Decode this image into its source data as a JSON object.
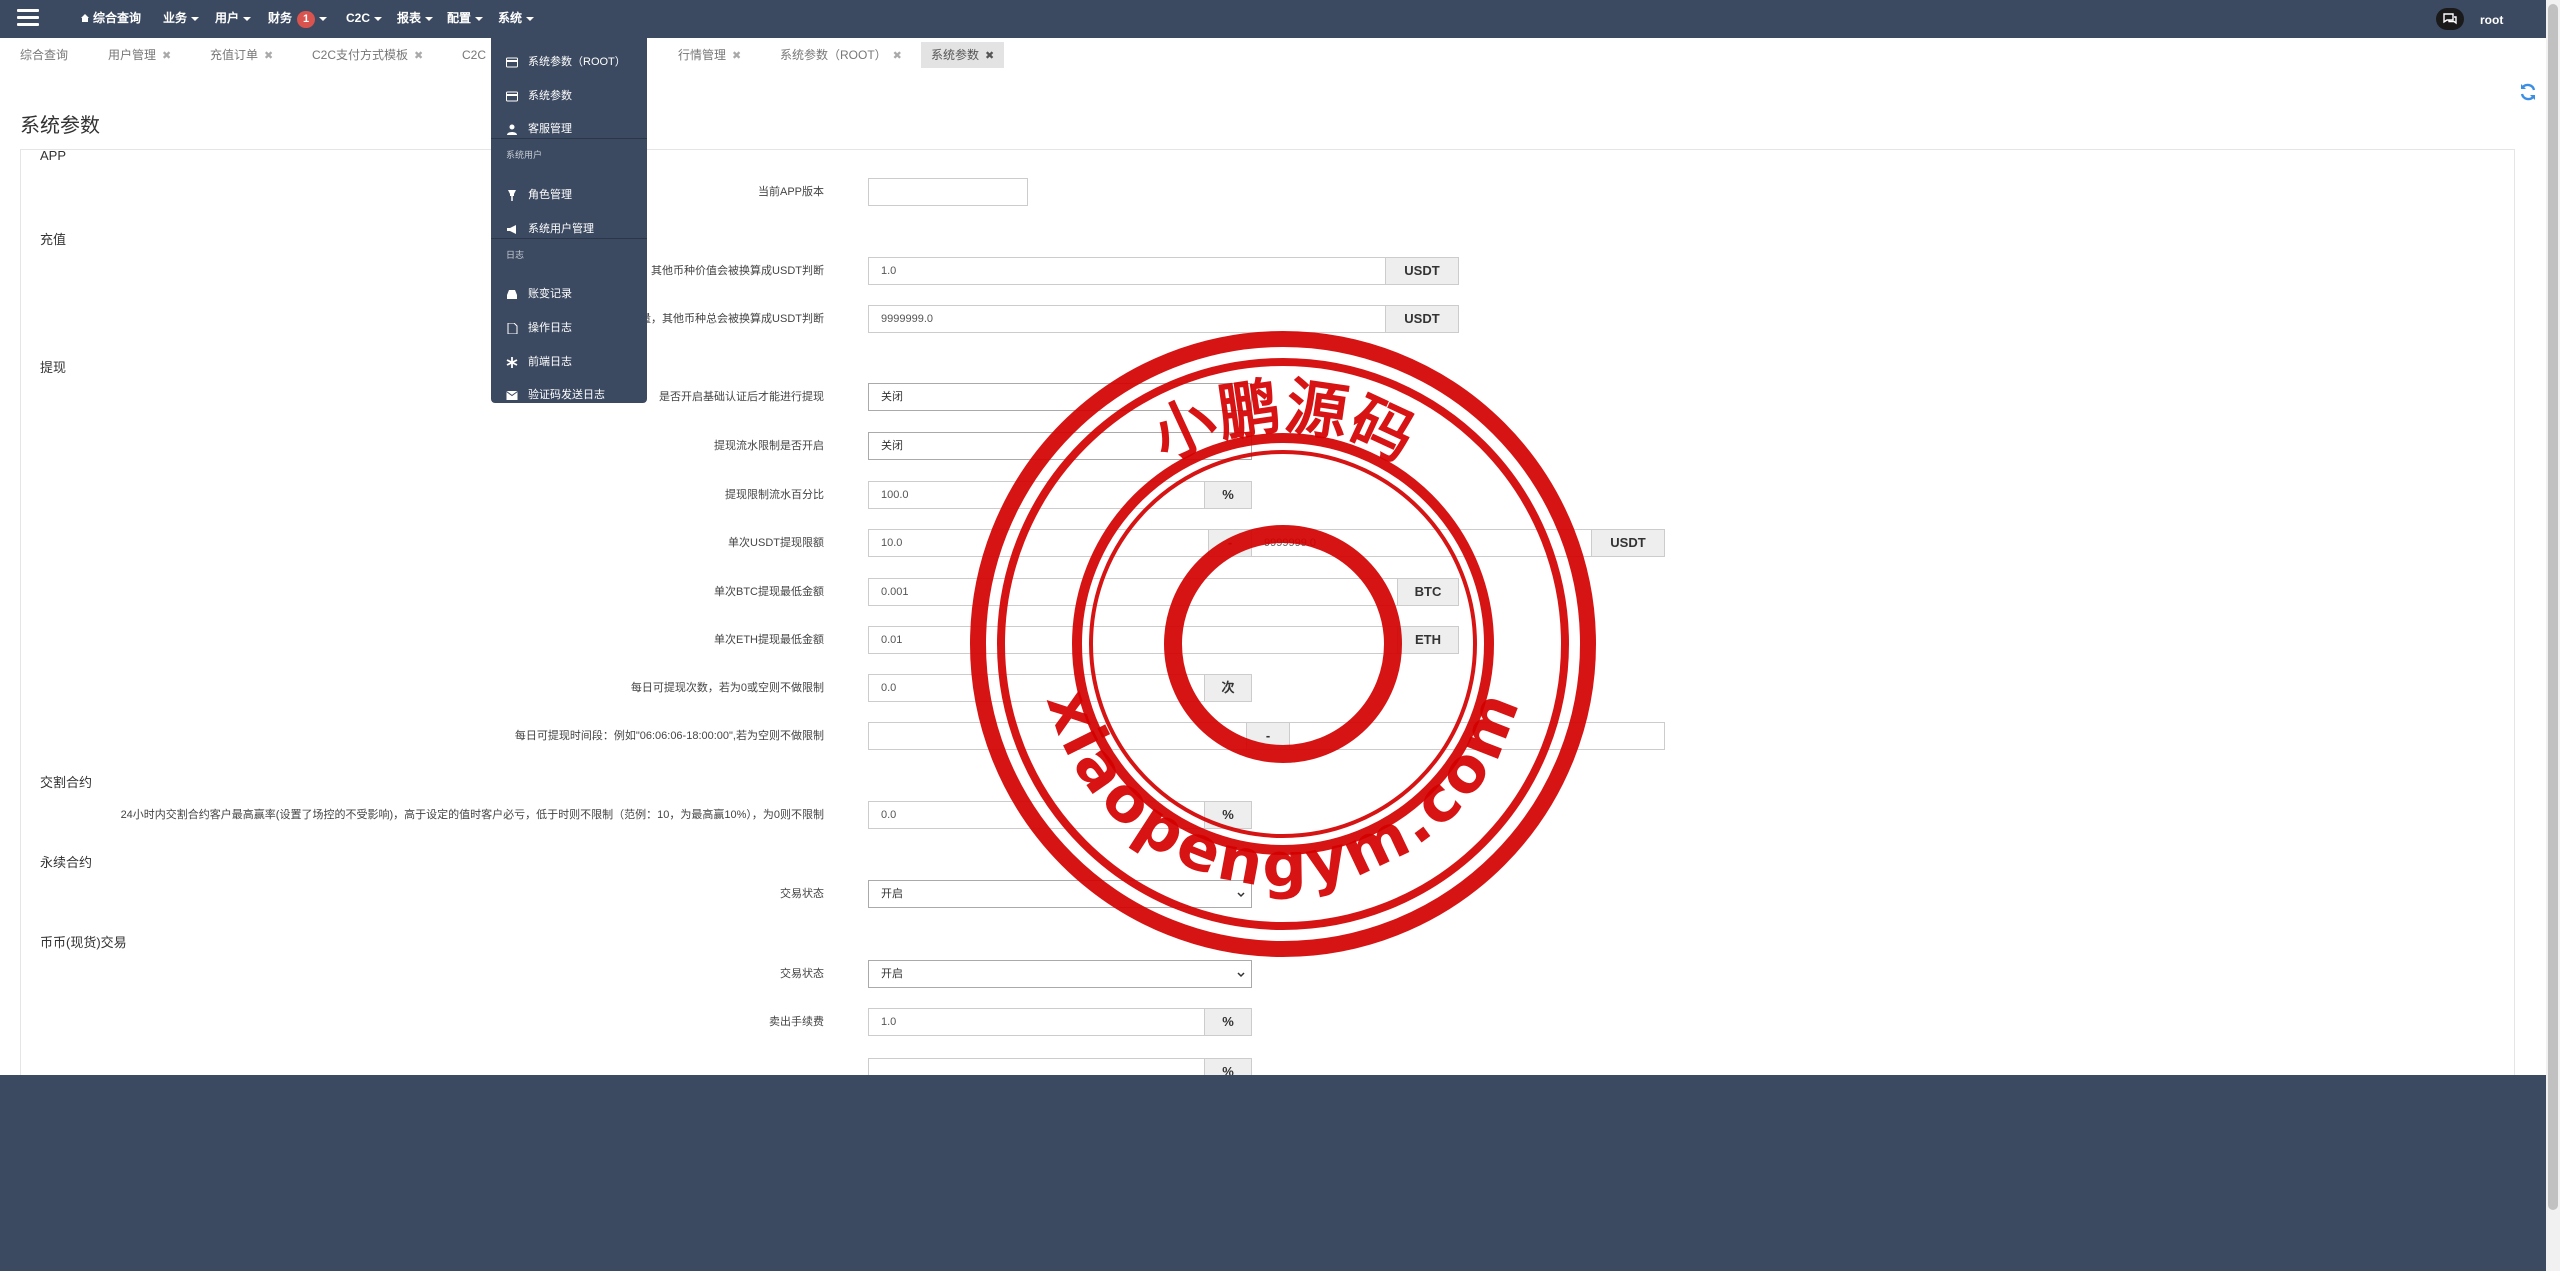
{
  "nav": {
    "home": "综合查询",
    "business": "业务",
    "users": "用户",
    "finance": "财务",
    "finance_badge": "1",
    "c2c": "C2C",
    "reports": "报表",
    "config": "配置",
    "system": "系统",
    "user_name": "root"
  },
  "tabs": [
    "综合查询",
    "用户管理",
    "充值订单",
    "C2C支付方式模板",
    "C2C",
    "行情管理",
    "系统参数（ROOT）",
    "系统参数"
  ],
  "page_title": "系统参数",
  "menu": {
    "items_top": [
      "系统参数（ROOT）",
      "系统参数",
      "客服管理"
    ],
    "header_users": "系统用户",
    "items_users": [
      "角色管理",
      "系统用户管理"
    ],
    "header_logs": "日志",
    "items_logs": [
      "账变记录",
      "操作日志",
      "前端日志",
      "验证码发送日志"
    ]
  },
  "sections": {
    "app": "APP",
    "recharge": "充值",
    "withdraw": "提现",
    "delivery": "交割合约",
    "perpetual": "永续合约",
    "spot": "币币(现货)交易"
  },
  "fields": {
    "app_version": {
      "label": "当前APP版本",
      "value": ""
    },
    "recharge_min": {
      "label": "量，其他币种价值会被换算成USDT判断",
      "value": "1.0",
      "unit": "USDT"
    },
    "recharge_max": {
      "label": "数量，其他币种总会被换算成USDT判断",
      "value": "9999999.0",
      "unit": "USDT"
    },
    "kyc_required": {
      "label": "是否开启基础认证后才能进行提现",
      "value": "关闭"
    },
    "flow_limit": {
      "label": "提现流水限制是否开启",
      "value": "关闭"
    },
    "flow_pct": {
      "label": "提现限制流水百分比",
      "value": "100.0",
      "unit": "%"
    },
    "usdt_single": {
      "label": "单次USDT提现限额",
      "min": "10.0",
      "sep": "-",
      "max": "9999999.0",
      "unit": "USDT"
    },
    "btc_min": {
      "label": "单次BTC提现最低金额",
      "value": "0.001",
      "unit": "BTC"
    },
    "eth_min": {
      "label": "单次ETH提现最低金额",
      "value": "0.01",
      "unit": "ETH"
    },
    "daily_count": {
      "label": "每日可提现次数，若为0或空则不做限制",
      "value": "0.0",
      "unit": "次"
    },
    "daily_time": {
      "label": "每日可提现时间段：例如\"06:06:06-18:00:00\",若为空则不做限制",
      "from": "",
      "sep": "-",
      "to": ""
    },
    "delivery_profit": {
      "label": "24小时内交割合约客户最高赢率(设置了场控的不受影响)，高于设定的值时客户必亏，低于时则不限制（范例：10，为最高赢10%），为0则不限制",
      "value": "0.0",
      "unit": "%"
    },
    "perp_status": {
      "label": "交易状态",
      "value": "开启"
    },
    "spot_status": {
      "label": "交易状态",
      "value": "开启"
    },
    "spot_sell_fee": {
      "label": "卖出手续费",
      "value": "1.0",
      "unit": "%"
    },
    "spot_next": {
      "unit": "%"
    }
  },
  "watermark": {
    "top": "小鹏源码",
    "bottom": "xiaopengym.com",
    "color": "#d40000"
  }
}
